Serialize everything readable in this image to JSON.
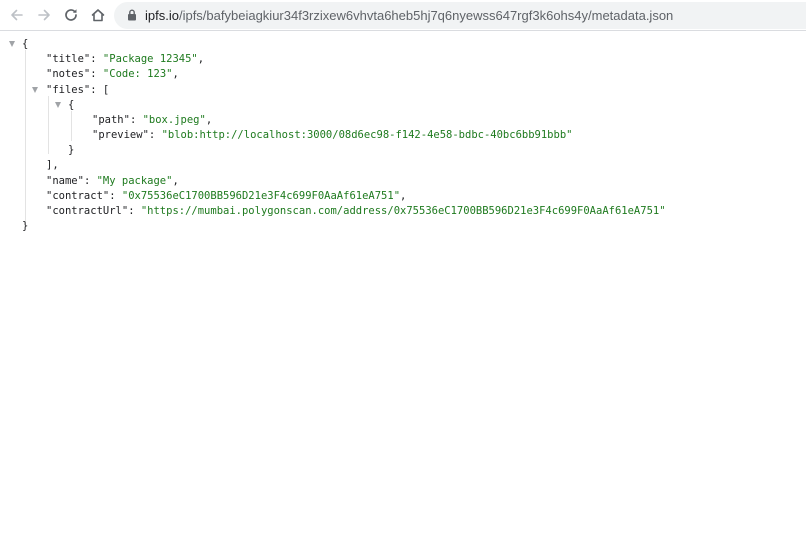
{
  "browser": {
    "url_host": "ipfs.io",
    "url_path": "/ipfs/bafybeiagkiur34f3rzixew6vhvta6heb5hj7q6nyewss647rgf3k6ohs4y/metadata.json"
  },
  "json": {
    "open_brace": "{",
    "close_brace": "}",
    "title_key": "\"title\"",
    "title_value": "\"Package 12345\"",
    "notes_key": "\"notes\"",
    "notes_value": "\"Code: 123\"",
    "files_key": "\"files\"",
    "files_open": "[",
    "files_close": "],",
    "item_open": "{",
    "item_close": "}",
    "path_key": "\"path\"",
    "path_value": "\"box.jpeg\"",
    "preview_key": "\"preview\"",
    "preview_value": "\"blob:http://localhost:3000/08d6ec98-f142-4e58-bdbc-40bc6bb91bbb\"",
    "name_key": "\"name\"",
    "name_value": "\"My package\"",
    "contract_key": "\"contract\"",
    "contract_value": "\"0x75536eC1700BB596D21e3F4c699F0AaAf61eA751\"",
    "contractUrl_key": "\"contractUrl\"",
    "contractUrl_value": "\"https://mumbai.polygonscan.com/address/0x75536eC1700BB596D21e3F4c699F0AaAf61eA751\""
  }
}
